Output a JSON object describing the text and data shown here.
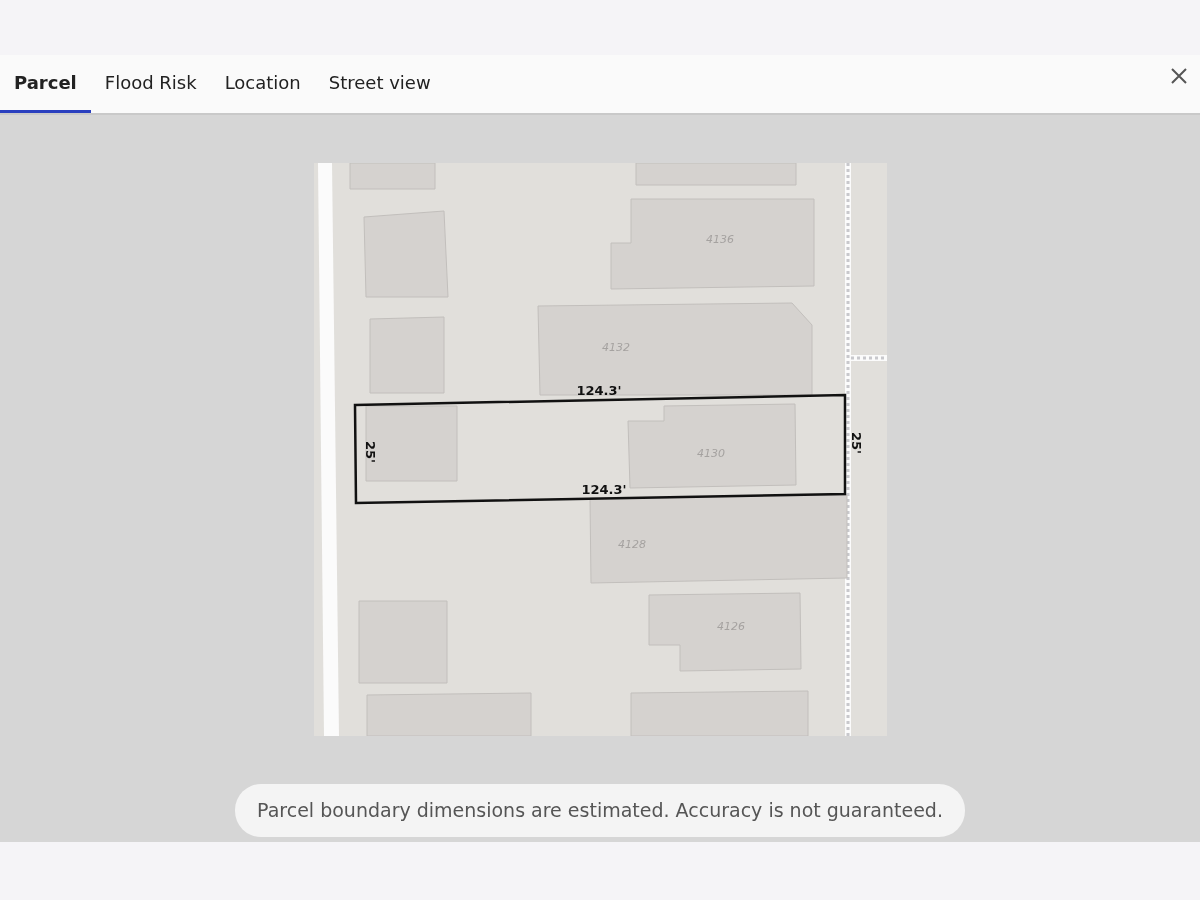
{
  "tabs": [
    {
      "label": "Parcel",
      "selected": true
    },
    {
      "label": "Flood Risk",
      "selected": false
    },
    {
      "label": "Location",
      "selected": false
    },
    {
      "label": "Street view",
      "selected": false
    }
  ],
  "map": {
    "house_numbers": [
      "4136",
      "4132",
      "4130",
      "4128",
      "4126"
    ],
    "dimensions": {
      "top": "124.3'",
      "bottom": "124.3'",
      "left": "25'",
      "right": "25'"
    }
  },
  "notice": "Parcel boundary dimensions are estimated. Accuracy is not guaranteed."
}
